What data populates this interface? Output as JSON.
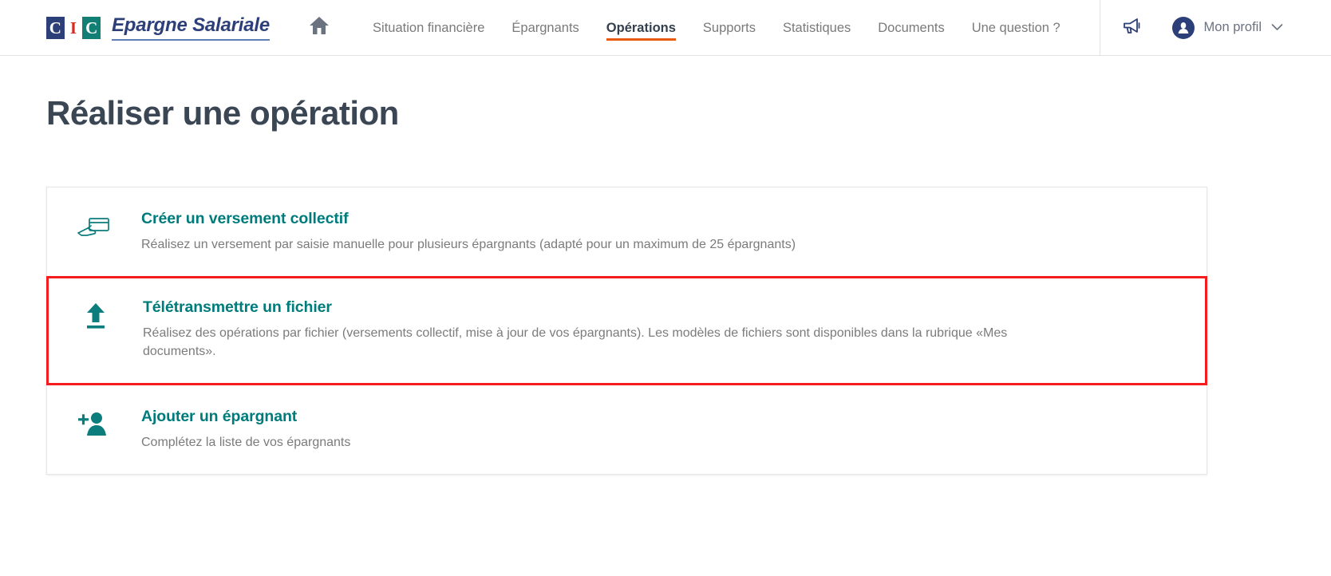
{
  "header": {
    "logo": {
      "block1": "C",
      "block2": "I",
      "block3": "C",
      "name": "Epargne Salariale"
    },
    "home_icon": "home-icon",
    "nav": [
      {
        "label": "Situation financière",
        "active": false
      },
      {
        "label": "Épargnants",
        "active": false
      },
      {
        "label": "Opérations",
        "active": true
      },
      {
        "label": "Supports",
        "active": false
      },
      {
        "label": "Statistiques",
        "active": false
      },
      {
        "label": "Documents",
        "active": false
      },
      {
        "label": "Une question ?",
        "active": false
      }
    ],
    "megaphone_icon": "megaphone-icon",
    "profile": {
      "label": "Mon profil",
      "chevron": "chevron-down-icon",
      "avatar": "user-avatar-icon"
    }
  },
  "main": {
    "title": "Réaliser une opération",
    "cards": [
      {
        "icon": "hand-card-icon",
        "title": "Créer un versement collectif",
        "description": "Réalisez un versement par saisie manuelle pour plusieurs épargnants (adapté pour un maximum de 25 épargnants)",
        "highlighted": false
      },
      {
        "icon": "upload-icon",
        "title": "Télétransmettre un fichier",
        "description": "Réalisez des opérations par fichier (versements collectif, mise à jour de vos épargnants). Les modèles de fichiers sont disponibles dans la rubrique «Mes documents».",
        "highlighted": true
      },
      {
        "icon": "add-person-icon",
        "title": "Ajouter un épargnant",
        "description": "Complétez la liste de vos épargnants",
        "highlighted": false
      }
    ]
  },
  "colors": {
    "brand_blue": "#2c3f78",
    "brand_teal": "#117f74",
    "accent_orange": "#e8590c",
    "link_teal": "#007b7b",
    "highlight_red": "#f41c1c",
    "title_slate": "#3b4654"
  }
}
